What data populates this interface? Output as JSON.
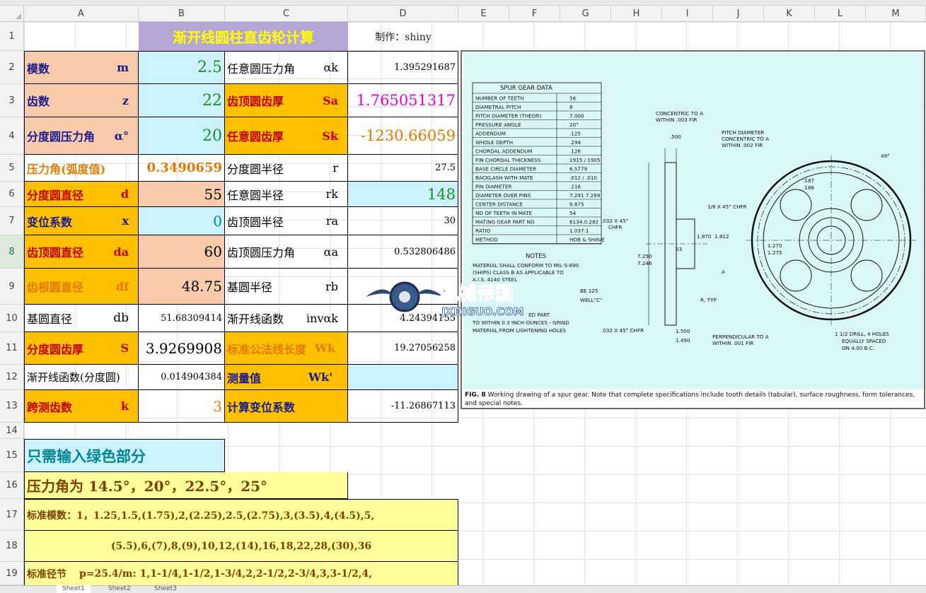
{
  "sheet": {
    "columns": [
      "A",
      "B",
      "C",
      "D",
      "E",
      "F",
      "G",
      "H",
      "I",
      "J",
      "K",
      "L",
      "M"
    ],
    "rows": [
      "1",
      "2",
      "3",
      "4",
      "5",
      "6",
      "7",
      "8",
      "9",
      "10",
      "11",
      "12",
      "13",
      "14",
      "15",
      "16",
      "17",
      "18",
      "19"
    ],
    "selected_row": "8"
  },
  "header": {
    "title": "渐开线圆柱直齿轮计算",
    "author": "制作：shiny"
  },
  "left": [
    {
      "label": "模数",
      "symbol": "m",
      "value": "2.5"
    },
    {
      "label": "齿数",
      "symbol": "z",
      "value": "22"
    },
    {
      "label": "分度圆压力角",
      "symbol": "α°",
      "value": "20"
    },
    {
      "label": "压力角(弧度值)",
      "symbol": "",
      "value": "0.3490659"
    },
    {
      "label": "分度圆直径",
      "symbol": "d",
      "value": "55"
    },
    {
      "label": "变位系数",
      "symbol": "x",
      "value": "0"
    },
    {
      "label": "齿顶圆直径",
      "symbol": "da",
      "value": "60"
    },
    {
      "label": "齿根圆直径",
      "symbol": "df",
      "value": "48.75"
    },
    {
      "label": "基圆直径",
      "symbol": "db",
      "value": "51.68309414"
    },
    {
      "label": "分度圆齿厚",
      "symbol": "S",
      "value": "3.9269908"
    },
    {
      "label": "渐开线函数(分度圆)",
      "symbol": "",
      "value": "0.014904384"
    },
    {
      "label": "跨测齿数",
      "symbol": "k",
      "value": "3"
    }
  ],
  "right": [
    {
      "label": "任意圆压力角",
      "symbol": "αk",
      "value": "1.395291687"
    },
    {
      "label": "齿顶圆齿厚",
      "symbol": "Sa",
      "value": "1.765051317"
    },
    {
      "label": "任意圆齿厚",
      "symbol": "Sk",
      "value": "-1230.66059"
    },
    {
      "label": "分度圆半径",
      "symbol": "r",
      "value": "27.5"
    },
    {
      "label": "任意圆半径",
      "symbol": "rk",
      "value": "148"
    },
    {
      "label": "齿顶圆半径",
      "symbol": "ra",
      "value": "30"
    },
    {
      "label": "齿顶圆压力角",
      "symbol": "αa",
      "value": "0.532806486"
    },
    {
      "label": "基圆半径",
      "symbol": "rb",
      "value": ""
    },
    {
      "label": "渐开线函数",
      "symbol": "invαk",
      "value": "4.24394155"
    },
    {
      "label": "标准公法线长度",
      "symbol": "Wk",
      "value": "19.27056258"
    },
    {
      "label": "测量值",
      "symbol": "Wk'",
      "value": ""
    },
    {
      "label": "计算变位系数",
      "symbol": "",
      "value": "-11.26867113"
    }
  ],
  "notes": {
    "green_only": "只需输入绿色部分",
    "pressure_angles": "压力角为 14.5°，20°，22.5°，25°",
    "std_module_1": "标准模数：1，1.25,1.5,(1.75),2,(2.25),2.5,(2.75),3,(3.5),4,(4.5),5,",
    "std_module_2": "(5.5),6,(7),8,(9),10,12,(14),16,18,22,28,(30),36",
    "std_pitch_label": "标准径节",
    "std_pitch": "p=25.4/m:    1,1-1/4,1-1/2,1-3/4,2,2-1/2,2-3/4,3,3-1/2,4,"
  },
  "drawing": {
    "table_title": "SPUR GEAR DATA",
    "table": [
      [
        "NUMBER OF TEETH",
        "56"
      ],
      [
        "DIAMETRAL PITCH",
        "8"
      ],
      [
        "PITCH DIAMETER (THEOR)",
        "7.000"
      ],
      [
        "PRESSURE ANGLE",
        "20°"
      ],
      [
        "ADDENDUM",
        ".125"
      ],
      [
        "WHOLE DEPTH",
        ".294"
      ],
      [
        "CHORDAL ADDENDUM",
        ".126"
      ],
      [
        "FIN CHORDAL THICKNESS",
        "1915 / 1905"
      ],
      [
        "BASE CIRCLE DIAMETER",
        "6.5779"
      ],
      [
        "BACKLASH WITH MATE",
        ".012 / .010"
      ],
      [
        "PIN DIAMETER",
        ".216"
      ],
      [
        "DIAMETER OVER PINS",
        "7.291 7.289"
      ],
      [
        "CENTER DISTANCE",
        "6.875"
      ],
      [
        "NO OF TEETH IN MATE",
        "54"
      ],
      [
        "MATING GEAR PART NO",
        "6134.0.282"
      ],
      [
        "RATIO",
        "1.037:1"
      ],
      [
        "METHOD",
        "HOB & SHAVE"
      ]
    ],
    "notes_title": "NOTES",
    "notes_lines": [
      "MATERIAL SHALL CONFORM TO MIL-S-890",
      "(SHIPS) CLASS B AS APPLICABLE TO",
      "A.I.S. 4140 STEEL",
      "ED PART",
      "TO WITHIN 0.3 INCH-OUNCES - GRIND",
      "MATERIAL FROM LIGHTENING HOLES"
    ],
    "callouts": [
      "CONCENTRIC TO A",
      "WITHIN .003 FIR",
      "PITCH DIAMETER",
      "CONCENTRIC TO A",
      "WITHIN .002 FIR",
      ".500",
      "1/8 X 45° CHFR",
      ".032 X 45°",
      "CHFR",
      "R, TYP",
      ".032 X 45° CHFR",
      "1.500",
      "1.490",
      "PERPENDICULAR TO A",
      "WITHIN .001 FIR",
      "1 1/2 DRILL, 4 HOLES",
      "EQUALLY SPACED",
      "ON 4.00 B.C.",
      "7.250",
      "7.246",
      "1.870",
      "1.812",
      "1.270",
      "1.275",
      ".187",
      ".188",
      "63",
      "A",
      "49°",
      "BE 125",
      "WELL\"C\""
    ],
    "caption_bold": "FIG. 8",
    "caption": "Working drawing of a spur gear. Note that complete specifications include tooth details (tabular), surface roughness, form tolerances, and special notes."
  },
  "watermark": {
    "cn": "机械帝国",
    "en": "JXDIGUO.COM"
  },
  "tabs": [
    "Sheet1",
    "Sheet2",
    "Sheet3"
  ],
  "colors": {
    "green_val": "#1e8f1e",
    "teal_val": "#00878f",
    "orange_val": "#e07a00",
    "magenta_val": "#e000e0",
    "red_label": "#c00000",
    "navy_label": "#1a1a8c",
    "title_yellow": "#ffff00"
  }
}
